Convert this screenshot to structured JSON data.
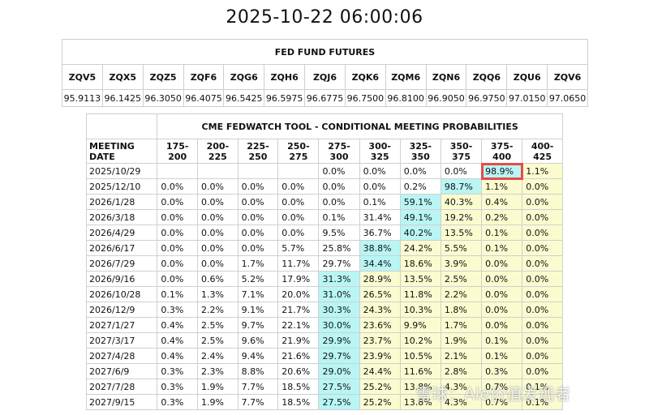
{
  "timestamp": "2025-10-22 06:00:06",
  "futures": {
    "caption": "FED FUND FUTURES",
    "codes": [
      "ZQV5",
      "ZQX5",
      "ZQZ5",
      "ZQF6",
      "ZQG6",
      "ZQH6",
      "ZQJ6",
      "ZQK6",
      "ZQM6",
      "ZQN6",
      "ZQQ6",
      "ZQU6",
      "ZQV6"
    ],
    "prices": [
      "95.9113",
      "96.1425",
      "96.3050",
      "96.4075",
      "96.5425",
      "96.5975",
      "96.6775",
      "96.7500",
      "96.8100",
      "96.9050",
      "96.9750",
      "97.0150",
      "97.0650"
    ]
  },
  "fedwatch": {
    "caption": "CME FEDWATCH TOOL - CONDITIONAL MEETING PROBABILITIES",
    "meeting_header": "MEETING DATE",
    "ranges": [
      "175-200",
      "200-225",
      "225-250",
      "250-275",
      "275-300",
      "300-325",
      "325-350",
      "350-375",
      "375-400",
      "400-425"
    ],
    "rows": [
      {
        "date": "2025/10/29",
        "values": [
          "",
          "",
          "",
          "",
          "0.0%",
          "0.0%",
          "0.0%",
          "0.0%",
          "98.9%",
          "1.1%"
        ],
        "peak": 8,
        "boxed": true
      },
      {
        "date": "2025/12/10",
        "values": [
          "0.0%",
          "0.0%",
          "0.0%",
          "0.0%",
          "0.0%",
          "0.0%",
          "0.2%",
          "98.7%",
          "1.1%",
          "0.0%"
        ],
        "peak": 7
      },
      {
        "date": "2026/1/28",
        "values": [
          "0.0%",
          "0.0%",
          "0.0%",
          "0.0%",
          "0.0%",
          "0.1%",
          "59.1%",
          "40.3%",
          "0.4%",
          "0.0%"
        ],
        "peak": 6
      },
      {
        "date": "2026/3/18",
        "values": [
          "0.0%",
          "0.0%",
          "0.0%",
          "0.0%",
          "0.1%",
          "31.4%",
          "49.1%",
          "19.2%",
          "0.2%",
          "0.0%"
        ],
        "peak": 6
      },
      {
        "date": "2026/4/29",
        "values": [
          "0.0%",
          "0.0%",
          "0.0%",
          "0.0%",
          "9.5%",
          "36.7%",
          "40.2%",
          "13.5%",
          "0.1%",
          "0.0%"
        ],
        "peak": 6
      },
      {
        "date": "2026/6/17",
        "values": [
          "0.0%",
          "0.0%",
          "0.0%",
          "5.7%",
          "25.8%",
          "38.8%",
          "24.2%",
          "5.5%",
          "0.1%",
          "0.0%"
        ],
        "peak": 5
      },
      {
        "date": "2026/7/29",
        "values": [
          "0.0%",
          "0.0%",
          "1.7%",
          "11.7%",
          "29.7%",
          "34.4%",
          "18.6%",
          "3.9%",
          "0.0%",
          "0.0%"
        ],
        "peak": 5
      },
      {
        "date": "2026/9/16",
        "values": [
          "0.0%",
          "0.6%",
          "5.2%",
          "17.9%",
          "31.3%",
          "28.9%",
          "13.5%",
          "2.5%",
          "0.0%",
          "0.0%"
        ],
        "peak": 4
      },
      {
        "date": "2026/10/28",
        "values": [
          "0.1%",
          "1.3%",
          "7.1%",
          "20.0%",
          "31.0%",
          "26.5%",
          "11.8%",
          "2.2%",
          "0.0%",
          "0.0%"
        ],
        "peak": 4
      },
      {
        "date": "2026/12/9",
        "values": [
          "0.3%",
          "2.2%",
          "9.1%",
          "21.7%",
          "30.3%",
          "24.3%",
          "10.3%",
          "1.8%",
          "0.0%",
          "0.0%"
        ],
        "peak": 4
      },
      {
        "date": "2027/1/27",
        "values": [
          "0.4%",
          "2.5%",
          "9.7%",
          "22.1%",
          "30.0%",
          "23.6%",
          "9.9%",
          "1.7%",
          "0.0%",
          "0.0%"
        ],
        "peak": 4
      },
      {
        "date": "2027/3/17",
        "values": [
          "0.4%",
          "2.5%",
          "9.6%",
          "21.9%",
          "29.9%",
          "23.7%",
          "10.2%",
          "1.9%",
          "0.1%",
          "0.0%"
        ],
        "peak": 4
      },
      {
        "date": "2027/4/28",
        "values": [
          "0.4%",
          "2.4%",
          "9.4%",
          "21.6%",
          "29.7%",
          "23.9%",
          "10.5%",
          "2.1%",
          "0.1%",
          "0.0%"
        ],
        "peak": 4
      },
      {
        "date": "2027/6/9",
        "values": [
          "0.3%",
          "2.3%",
          "8.8%",
          "20.6%",
          "29.0%",
          "24.4%",
          "11.6%",
          "2.8%",
          "0.3%",
          "0.0%"
        ],
        "peak": 4
      },
      {
        "date": "2027/7/28",
        "values": [
          "0.3%",
          "1.9%",
          "7.7%",
          "18.5%",
          "27.5%",
          "25.2%",
          "13.8%",
          "4.3%",
          "0.7%",
          "0.1%"
        ],
        "peak": 4
      },
      {
        "date": "2027/9/15",
        "values": [
          "0.3%",
          "1.9%",
          "7.7%",
          "18.5%",
          "27.5%",
          "25.2%",
          "13.8%",
          "4.3%",
          "0.7%",
          "0.1%"
        ],
        "peak": 4
      }
    ]
  },
  "watermark": "雪球：Ale价值发现者",
  "colors": {
    "peak": "#b9f5f5",
    "above_peak": "#fbfbd0",
    "box": "#e84a4a"
  }
}
